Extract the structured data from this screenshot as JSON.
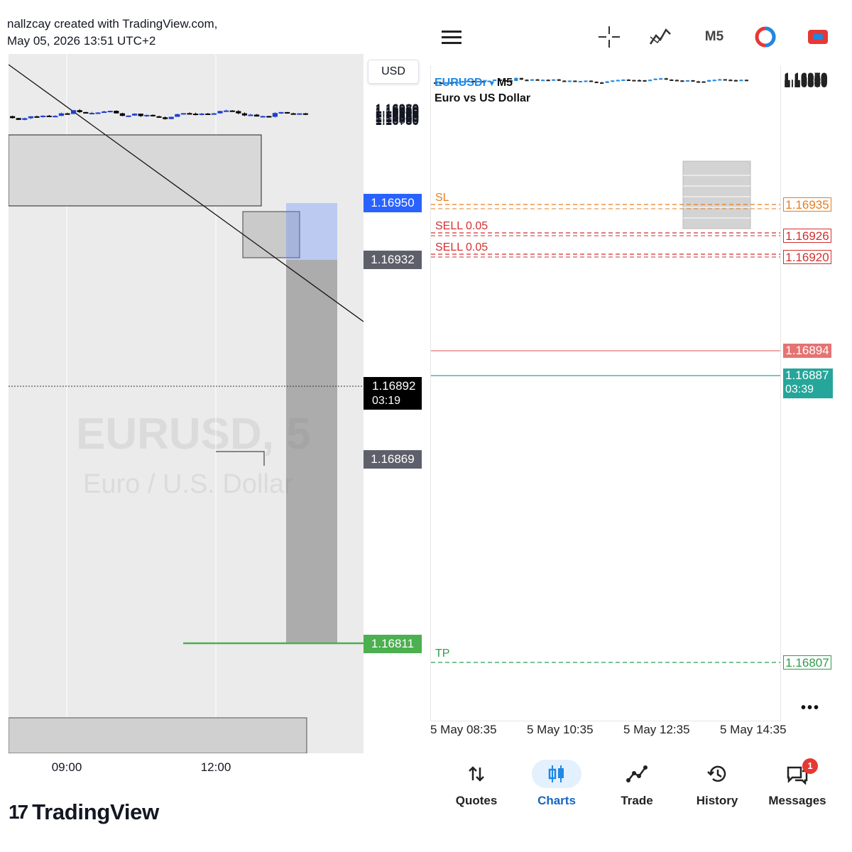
{
  "tradingview": {
    "header_line1": "nallzcay created with TradingView.com,",
    "header_line2": "May 05, 2026 13:51 UTC+2",
    "currency_button": "USD",
    "watermark_symbol": "EURUSD, 5",
    "watermark_name": "Euro / U.S. Dollar",
    "logo_text": "TradingView",
    "logo_mark": "17",
    "price_ticks": [
      "1.16980",
      "1.16970",
      "1.16960",
      "1.16940",
      "1.16930",
      "1.16920",
      "1.16910",
      "1.16900",
      "1.16880",
      "1.16860",
      "1.16850",
      "1.16840",
      "1.16830",
      "1.16820",
      "1.16800",
      "1.16790",
      "1.16780"
    ],
    "tags": {
      "upper_target": "1.16950",
      "entry": "1.16932",
      "current_price": "1.16892",
      "countdown": "03:19",
      "level": "1.16869",
      "take_profit": "1.16811"
    },
    "time_labels": [
      "09:00",
      "12:00"
    ],
    "colors": {
      "up": "#1e3fd0",
      "down": "#000000",
      "tp_line": "#4caf50",
      "tag_blue": "#2962ff",
      "tag_grey": "#5d606b",
      "tag_green": "#4caf50"
    }
  },
  "metatrader": {
    "toolbar": {
      "menu_icon": "hamburger-icon",
      "crosshair_icon": "crosshair-icon",
      "indicators_icon": "indicators-icon",
      "timeframe": "M5",
      "account_icon": "account-icon",
      "trade_icon": "trade-toggle-icon"
    },
    "symbol": "EURUSDr",
    "symbol_arrow": "▾",
    "timeframe": "M5",
    "description": "Euro vs US Dollar",
    "price_ticks": [
      "1.16970",
      "1.16960",
      "1.16950",
      "1.16940",
      "1.16930",
      "1.16910",
      "1.16900",
      "1.16890",
      "1.16880",
      "1.16870",
      "1.16860",
      "1.16850",
      "1.16840",
      "1.16830",
      "1.16820",
      "1.16810",
      "1.16800"
    ],
    "lines": {
      "sl_label": "SL",
      "sl_price": "1.16935",
      "sell1_label": "SELL 0.05",
      "sell1_price": "1.16926",
      "sell2_label": "SELL 0.05",
      "sell2_price": "1.16920",
      "bid_price": "1.16894",
      "ask_price": "1.16887",
      "countdown": "03:39",
      "tp_label": "TP",
      "tp_price": "1.16807"
    },
    "time_labels": [
      "5 May 08:35",
      "5 May 10:35",
      "5 May 12:35",
      "5 May 14:35"
    ],
    "more_icon": "•••",
    "nav": [
      {
        "label": "Quotes",
        "icon": "quotes-icon"
      },
      {
        "label": "Charts",
        "icon": "charts-icon"
      },
      {
        "label": "Trade",
        "icon": "trade-icon"
      },
      {
        "label": "History",
        "icon": "history-icon"
      },
      {
        "label": "Messages",
        "icon": "messages-icon",
        "badge": "1"
      }
    ],
    "colors": {
      "up": "#1e88e5",
      "down": "#222222",
      "sl": "#e67e22",
      "sell": "#d32f2f",
      "bid": "#e57373",
      "ask": "#26a69a",
      "tp": "#2e9d4a",
      "active_nav": "#1565c0"
    }
  }
}
